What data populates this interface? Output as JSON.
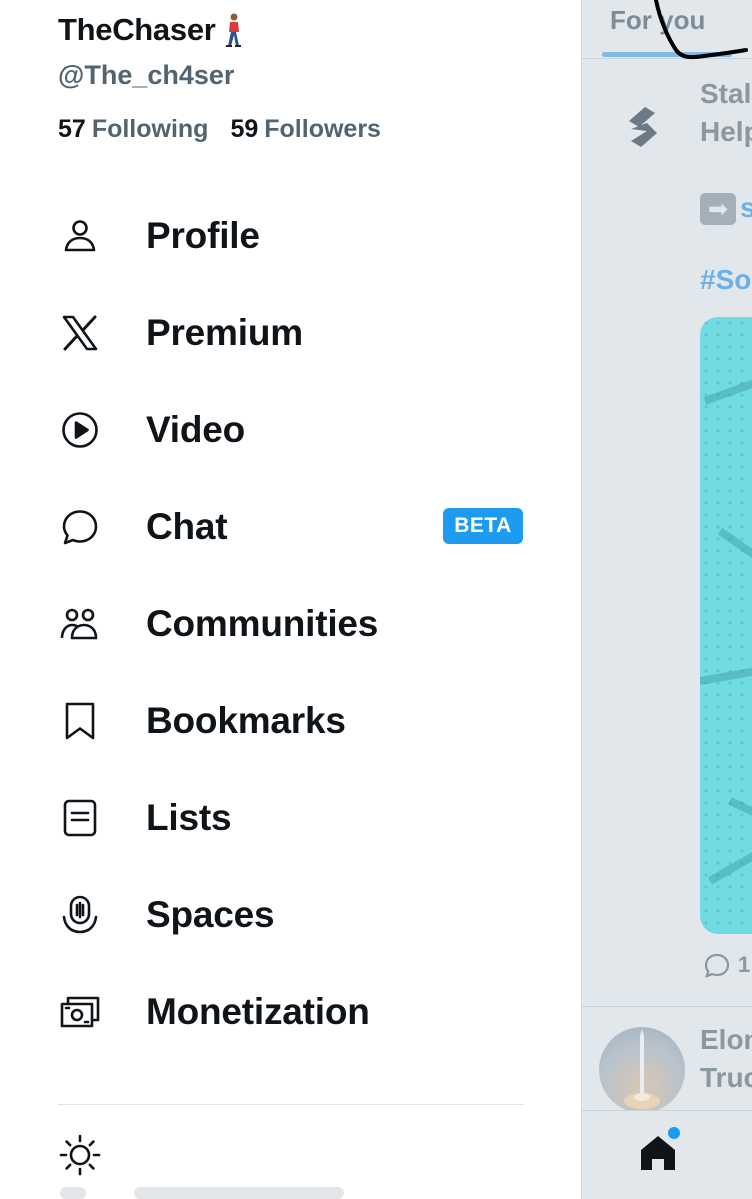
{
  "profile": {
    "name": "TheChaser",
    "handle": "@The_ch4ser",
    "following_count": "57",
    "following_label": "Following",
    "followers_count": "59",
    "followers_label": "Followers"
  },
  "menu": [
    {
      "label": "Profile",
      "icon": "person-icon"
    },
    {
      "label": "Premium",
      "icon": "x-logo-icon"
    },
    {
      "label": "Video",
      "icon": "play-circle-icon"
    },
    {
      "label": "Chat",
      "icon": "chat-bubble-icon",
      "badge": "BETA"
    },
    {
      "label": "Communities",
      "icon": "communities-icon"
    },
    {
      "label": "Bookmarks",
      "icon": "bookmark-icon"
    },
    {
      "label": "Lists",
      "icon": "list-icon"
    },
    {
      "label": "Spaces",
      "icon": "spaces-mic-icon"
    },
    {
      "label": "Monetization",
      "icon": "money-icon"
    }
  ],
  "footer": {
    "theme_icon": "sun-icon"
  },
  "timeline": {
    "tab_label": "For you",
    "post1": {
      "line1": "Stal",
      "line2": "Help",
      "arrow_text": "s",
      "hashtag": "#So",
      "reply_count": "1"
    },
    "post2": {
      "line1": "Elon",
      "line2": "Truc"
    }
  },
  "colors": {
    "accent": "#1d9bf0",
    "text_primary": "#0f1419",
    "text_secondary": "#536471",
    "overlay": "#e2e7ec"
  }
}
